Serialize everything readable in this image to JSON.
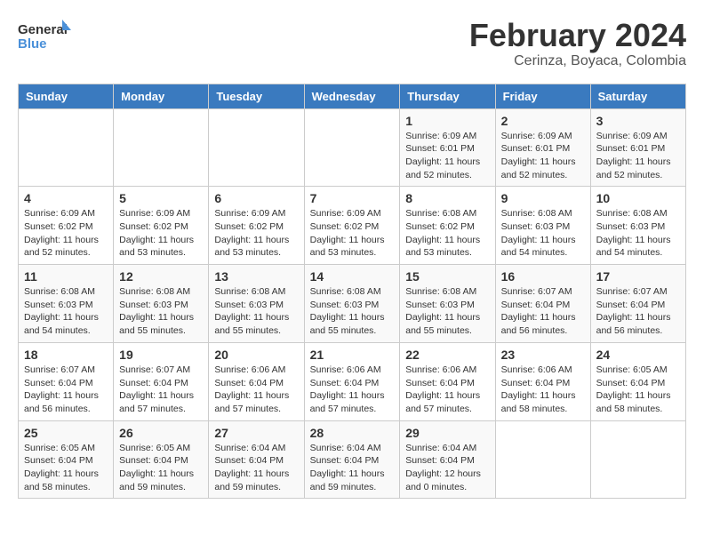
{
  "logo": {
    "line1": "General",
    "line2": "Blue"
  },
  "title": "February 2024",
  "subtitle": "Cerinza, Boyaca, Colombia",
  "days_header": [
    "Sunday",
    "Monday",
    "Tuesday",
    "Wednesday",
    "Thursday",
    "Friday",
    "Saturday"
  ],
  "weeks": [
    [
      {
        "day": "",
        "info": ""
      },
      {
        "day": "",
        "info": ""
      },
      {
        "day": "",
        "info": ""
      },
      {
        "day": "",
        "info": ""
      },
      {
        "day": "1",
        "info": "Sunrise: 6:09 AM\nSunset: 6:01 PM\nDaylight: 11 hours\nand 52 minutes."
      },
      {
        "day": "2",
        "info": "Sunrise: 6:09 AM\nSunset: 6:01 PM\nDaylight: 11 hours\nand 52 minutes."
      },
      {
        "day": "3",
        "info": "Sunrise: 6:09 AM\nSunset: 6:01 PM\nDaylight: 11 hours\nand 52 minutes."
      }
    ],
    [
      {
        "day": "4",
        "info": "Sunrise: 6:09 AM\nSunset: 6:02 PM\nDaylight: 11 hours\nand 52 minutes."
      },
      {
        "day": "5",
        "info": "Sunrise: 6:09 AM\nSunset: 6:02 PM\nDaylight: 11 hours\nand 53 minutes."
      },
      {
        "day": "6",
        "info": "Sunrise: 6:09 AM\nSunset: 6:02 PM\nDaylight: 11 hours\nand 53 minutes."
      },
      {
        "day": "7",
        "info": "Sunrise: 6:09 AM\nSunset: 6:02 PM\nDaylight: 11 hours\nand 53 minutes."
      },
      {
        "day": "8",
        "info": "Sunrise: 6:08 AM\nSunset: 6:02 PM\nDaylight: 11 hours\nand 53 minutes."
      },
      {
        "day": "9",
        "info": "Sunrise: 6:08 AM\nSunset: 6:03 PM\nDaylight: 11 hours\nand 54 minutes."
      },
      {
        "day": "10",
        "info": "Sunrise: 6:08 AM\nSunset: 6:03 PM\nDaylight: 11 hours\nand 54 minutes."
      }
    ],
    [
      {
        "day": "11",
        "info": "Sunrise: 6:08 AM\nSunset: 6:03 PM\nDaylight: 11 hours\nand 54 minutes."
      },
      {
        "day": "12",
        "info": "Sunrise: 6:08 AM\nSunset: 6:03 PM\nDaylight: 11 hours\nand 55 minutes."
      },
      {
        "day": "13",
        "info": "Sunrise: 6:08 AM\nSunset: 6:03 PM\nDaylight: 11 hours\nand 55 minutes."
      },
      {
        "day": "14",
        "info": "Sunrise: 6:08 AM\nSunset: 6:03 PM\nDaylight: 11 hours\nand 55 minutes."
      },
      {
        "day": "15",
        "info": "Sunrise: 6:08 AM\nSunset: 6:03 PM\nDaylight: 11 hours\nand 55 minutes."
      },
      {
        "day": "16",
        "info": "Sunrise: 6:07 AM\nSunset: 6:04 PM\nDaylight: 11 hours\nand 56 minutes."
      },
      {
        "day": "17",
        "info": "Sunrise: 6:07 AM\nSunset: 6:04 PM\nDaylight: 11 hours\nand 56 minutes."
      }
    ],
    [
      {
        "day": "18",
        "info": "Sunrise: 6:07 AM\nSunset: 6:04 PM\nDaylight: 11 hours\nand 56 minutes."
      },
      {
        "day": "19",
        "info": "Sunrise: 6:07 AM\nSunset: 6:04 PM\nDaylight: 11 hours\nand 57 minutes."
      },
      {
        "day": "20",
        "info": "Sunrise: 6:06 AM\nSunset: 6:04 PM\nDaylight: 11 hours\nand 57 minutes."
      },
      {
        "day": "21",
        "info": "Sunrise: 6:06 AM\nSunset: 6:04 PM\nDaylight: 11 hours\nand 57 minutes."
      },
      {
        "day": "22",
        "info": "Sunrise: 6:06 AM\nSunset: 6:04 PM\nDaylight: 11 hours\nand 57 minutes."
      },
      {
        "day": "23",
        "info": "Sunrise: 6:06 AM\nSunset: 6:04 PM\nDaylight: 11 hours\nand 58 minutes."
      },
      {
        "day": "24",
        "info": "Sunrise: 6:05 AM\nSunset: 6:04 PM\nDaylight: 11 hours\nand 58 minutes."
      }
    ],
    [
      {
        "day": "25",
        "info": "Sunrise: 6:05 AM\nSunset: 6:04 PM\nDaylight: 11 hours\nand 58 minutes."
      },
      {
        "day": "26",
        "info": "Sunrise: 6:05 AM\nSunset: 6:04 PM\nDaylight: 11 hours\nand 59 minutes."
      },
      {
        "day": "27",
        "info": "Sunrise: 6:04 AM\nSunset: 6:04 PM\nDaylight: 11 hours\nand 59 minutes."
      },
      {
        "day": "28",
        "info": "Sunrise: 6:04 AM\nSunset: 6:04 PM\nDaylight: 11 hours\nand 59 minutes."
      },
      {
        "day": "29",
        "info": "Sunrise: 6:04 AM\nSunset: 6:04 PM\nDaylight: 12 hours\nand 0 minutes."
      },
      {
        "day": "",
        "info": ""
      },
      {
        "day": "",
        "info": ""
      }
    ]
  ]
}
